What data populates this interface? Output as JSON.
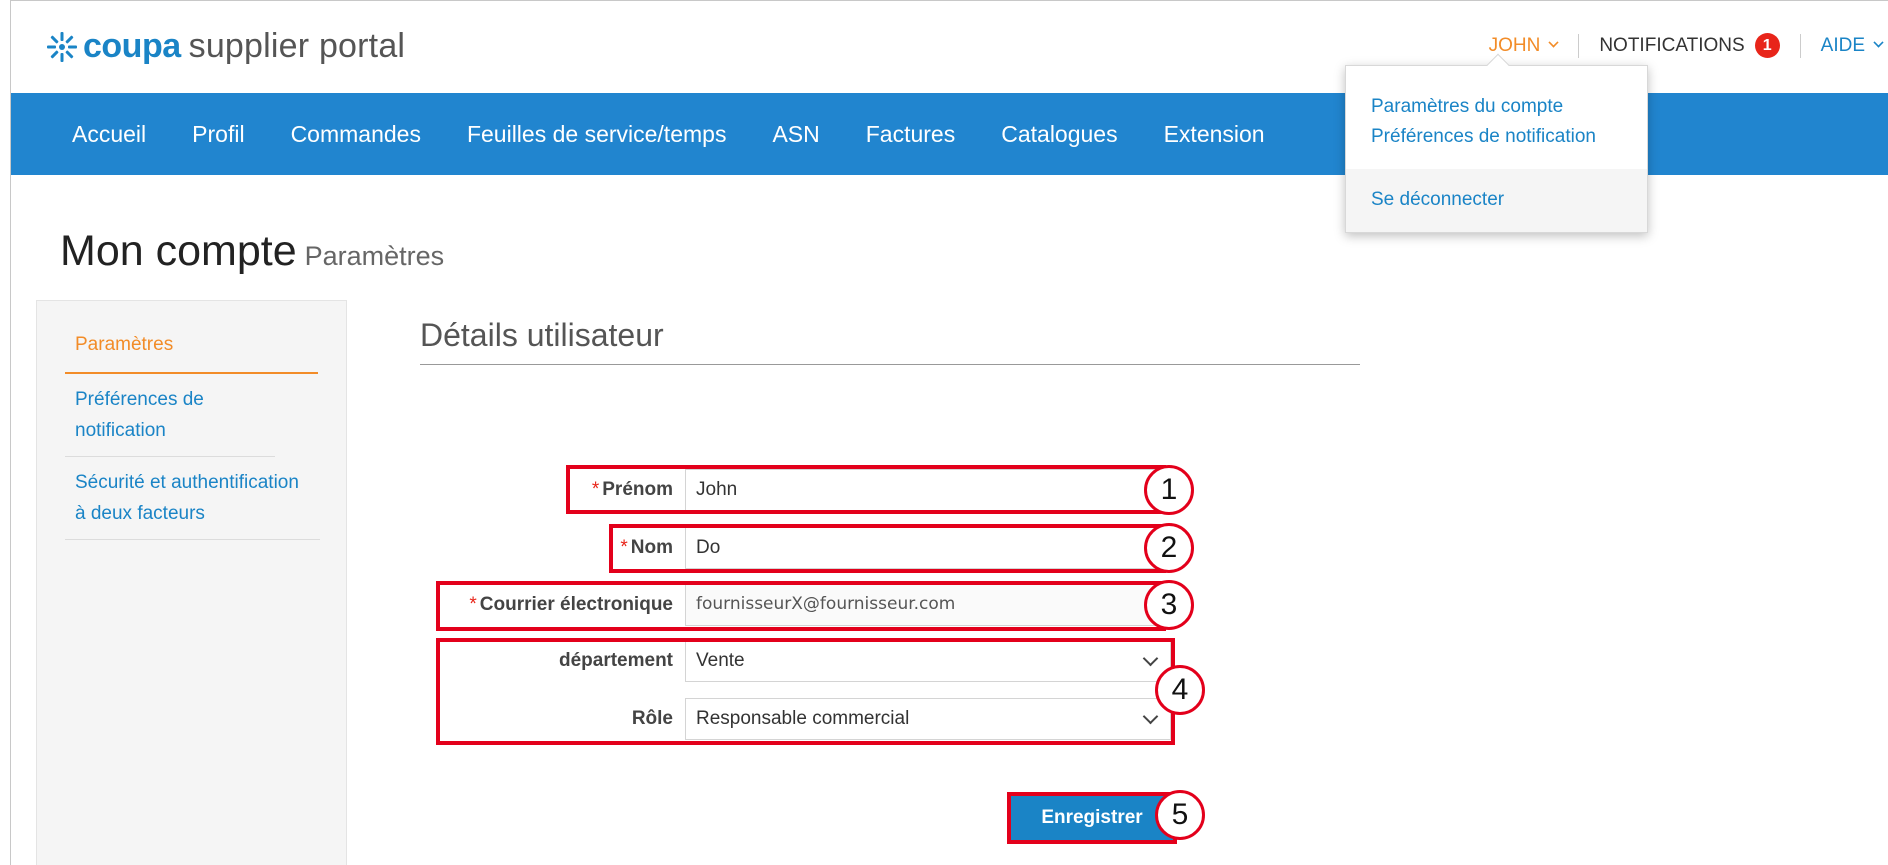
{
  "header": {
    "brand": "coupa",
    "brand_rest": "supplier portal",
    "user_name": "JOHN",
    "notifications_label": "NOTIFICATIONS",
    "notifications_count": "1",
    "help_label": "AIDE"
  },
  "nav": {
    "items": [
      {
        "label": "Accueil"
      },
      {
        "label": "Profil"
      },
      {
        "label": "Commandes"
      },
      {
        "label": "Feuilles de service/temps"
      },
      {
        "label": "ASN"
      },
      {
        "label": "Factures"
      },
      {
        "label": "Catalogues"
      },
      {
        "label": "Extension"
      }
    ]
  },
  "user_menu": {
    "account_settings": "Paramètres du compte",
    "notification_prefs": "Préférences de notification",
    "logout": "Se déconnecter"
  },
  "page": {
    "title": "Mon compte",
    "subtitle": "Paramètres"
  },
  "sidebar": {
    "items": [
      {
        "label": "Paramètres",
        "active": true
      },
      {
        "label": "Préférences de notification"
      },
      {
        "label": "Sécurité et authentification à deux facteurs"
      }
    ]
  },
  "form": {
    "section_title": "Détails utilisateur",
    "required_mark": "*",
    "first_name_label": "Prénom",
    "first_name_value": "John",
    "last_name_label": "Nom",
    "last_name_value": "Do",
    "email_label": "Courrier électronique",
    "email_value": "fournisseurX@fournisseur.com",
    "department_label": "département",
    "department_value": "Vente",
    "role_label": "Rôle",
    "role_value": "Responsable commercial",
    "save_label": "Enregistrer"
  },
  "callouts": {
    "n1": "1",
    "n2": "2",
    "n3": "3",
    "n4": "4",
    "n5": "5",
    "color": "#e3001b"
  },
  "colors": {
    "brand_blue": "#1a84c6",
    "nav_blue": "#2185cf",
    "accent_orange": "#f28c28",
    "badge_red": "#e8251a"
  }
}
